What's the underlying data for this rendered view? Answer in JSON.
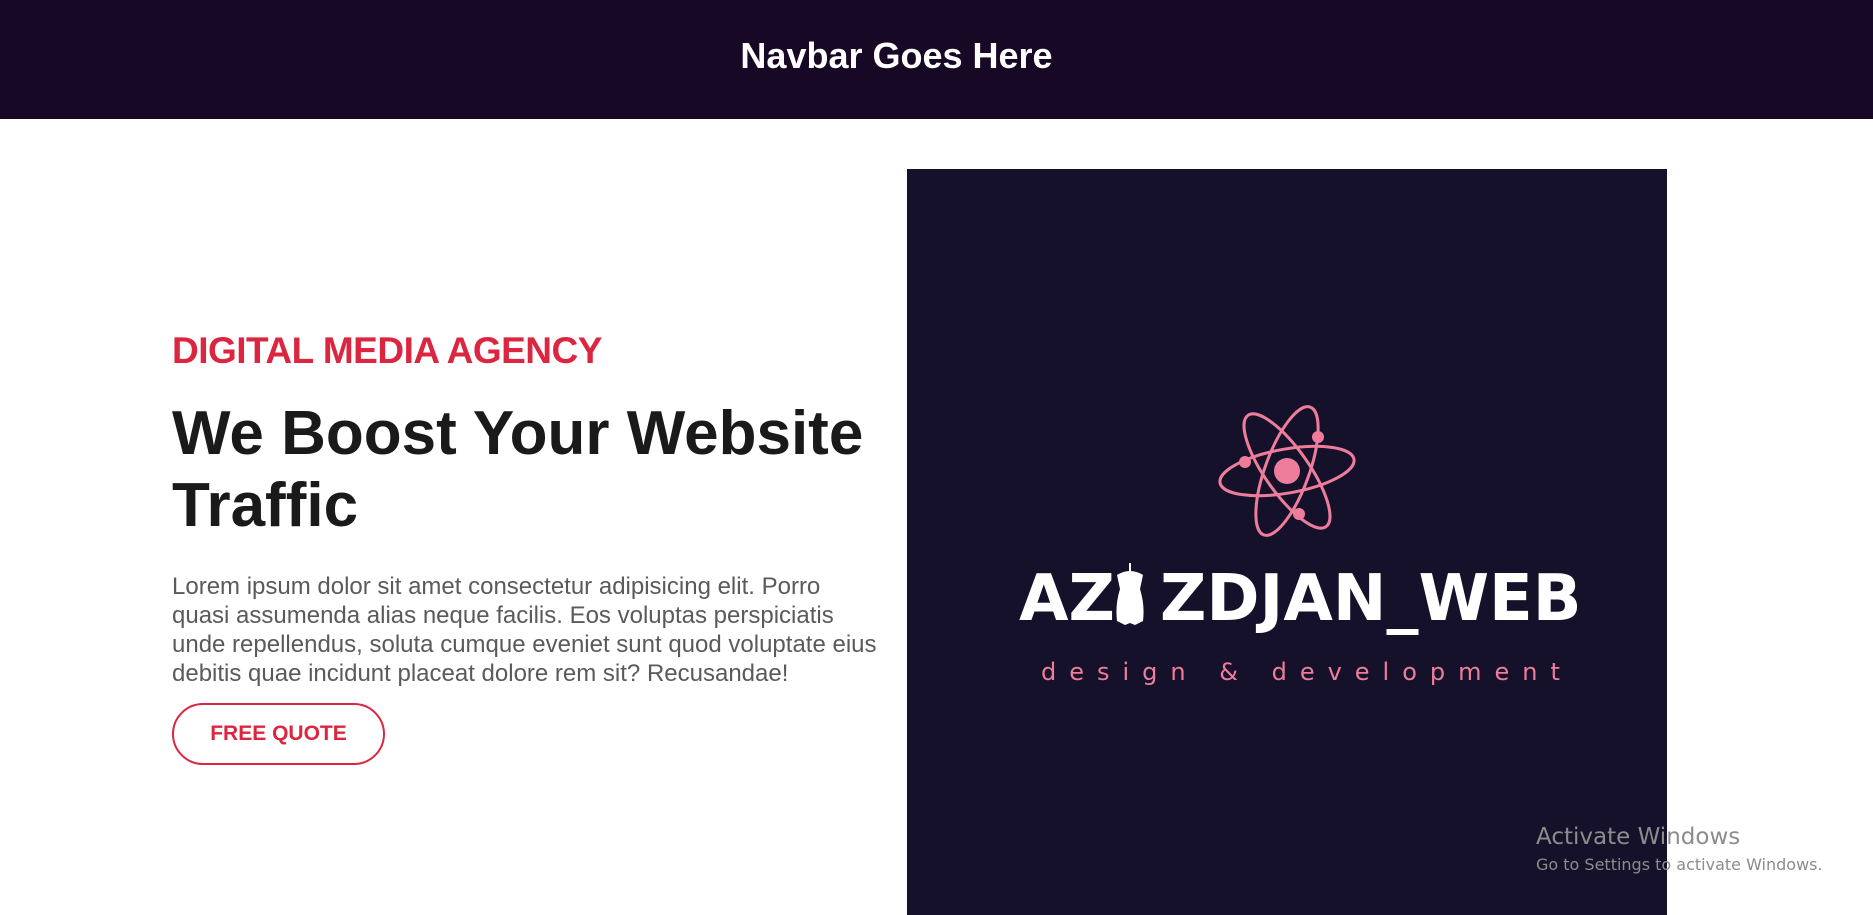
{
  "navbar": {
    "title": "Navbar Goes Here"
  },
  "hero": {
    "eyebrow": "DIGITAL MEDIA AGENCY",
    "headline": "We Boost Your Website Traffic",
    "body": "Lorem ipsum dolor sit amet consectetur adipisicing elit. Porro quasi assumenda alias neque facilis. Eos voluptas perspiciatis unde repellendus, soluta cumque eveniet sunt quod voluptate eius debitis quae incidunt placeat dolore rem sit? Recusandae!",
    "cta_label": "FREE QUOTE"
  },
  "logo": {
    "brand_text": "AZIZDJAN_WEB",
    "tagline": "design & development",
    "icon": "atom-icon",
    "brand_icon": "dress-form-icon"
  },
  "watermark": {
    "title": "Activate Windows",
    "subtitle": "Go to Settings to activate Windows."
  },
  "colors": {
    "navbar_bg": "#170826",
    "accent": "#dc2640",
    "logo_bg": "#16112a",
    "logo_pink": "#ee7d9b"
  }
}
